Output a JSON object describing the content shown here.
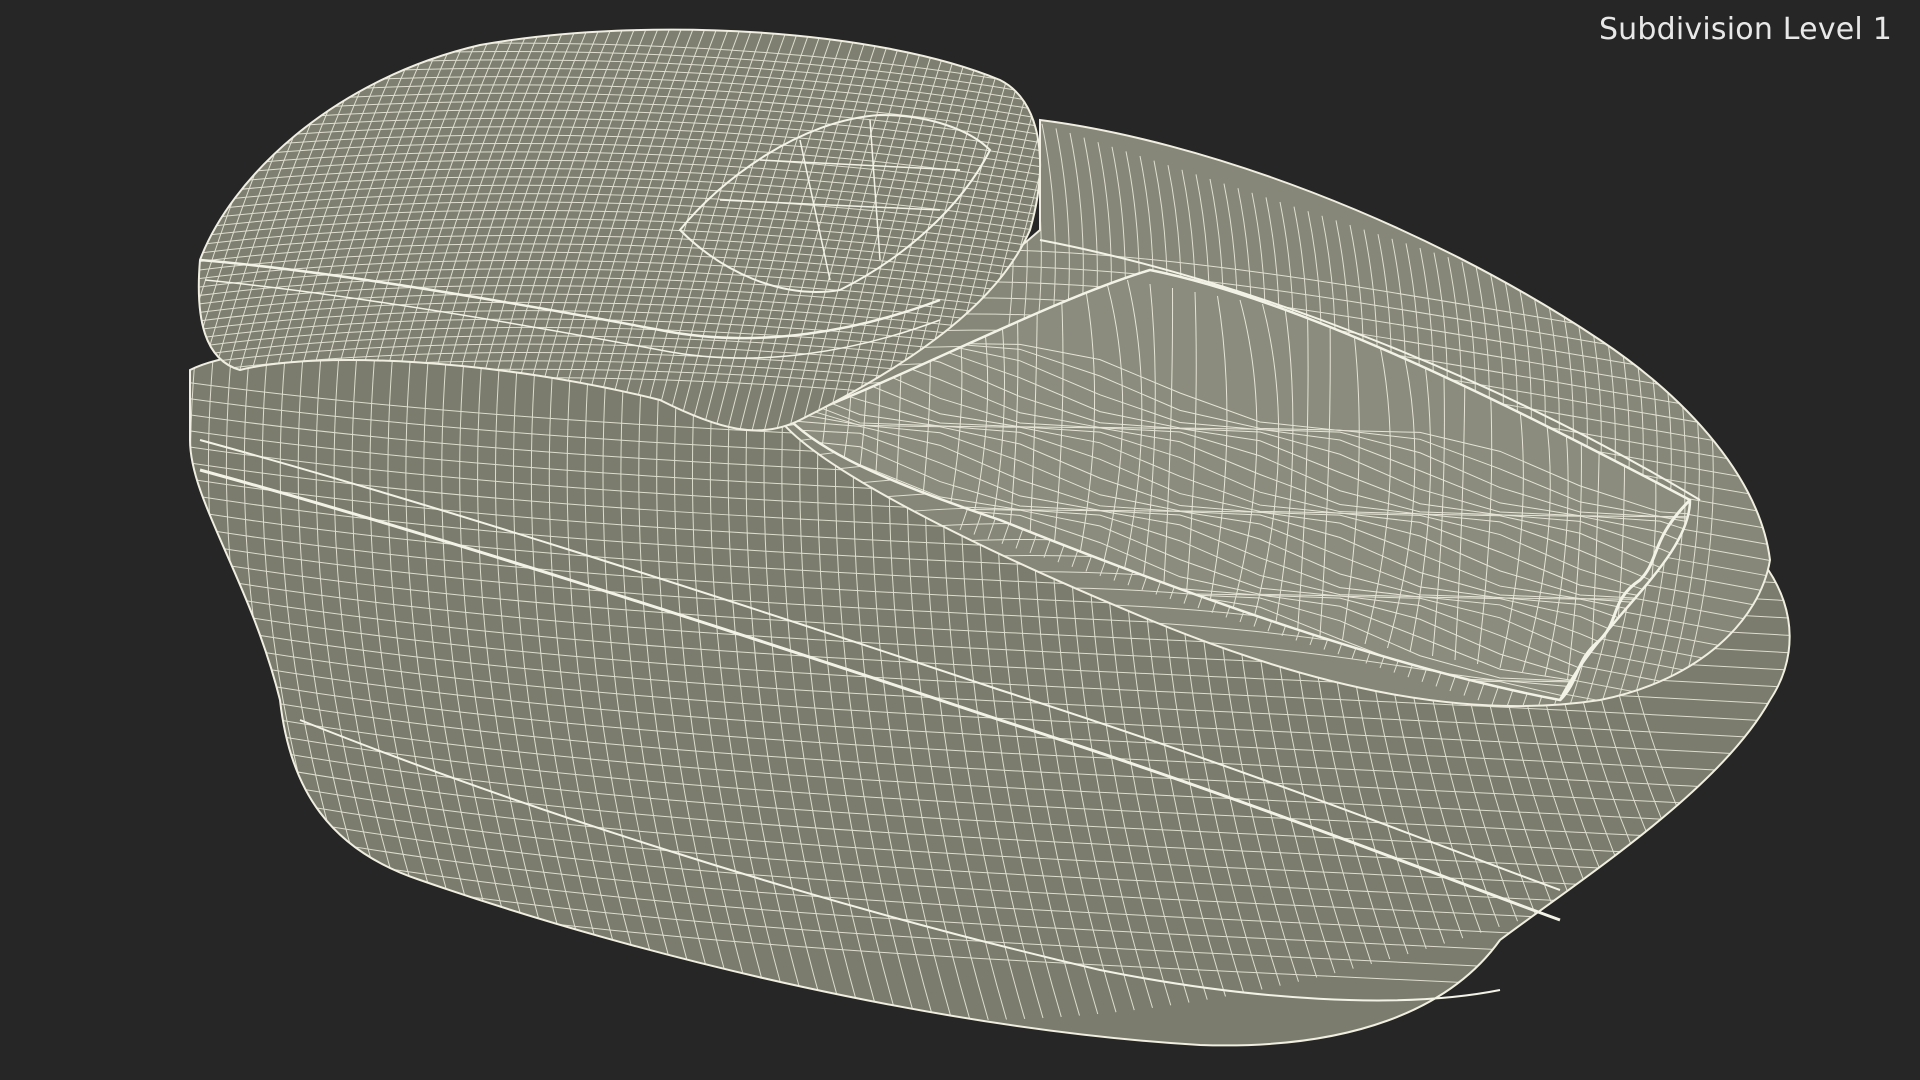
{
  "viewport": {
    "label": "Subdivision Level 1"
  },
  "colors": {
    "background": "#262626",
    "mesh_fill": "#7d7e6f",
    "mesh_fill_light": "#8a8b7c",
    "wire": "#efeee0",
    "label": "#e8e8e8"
  }
}
